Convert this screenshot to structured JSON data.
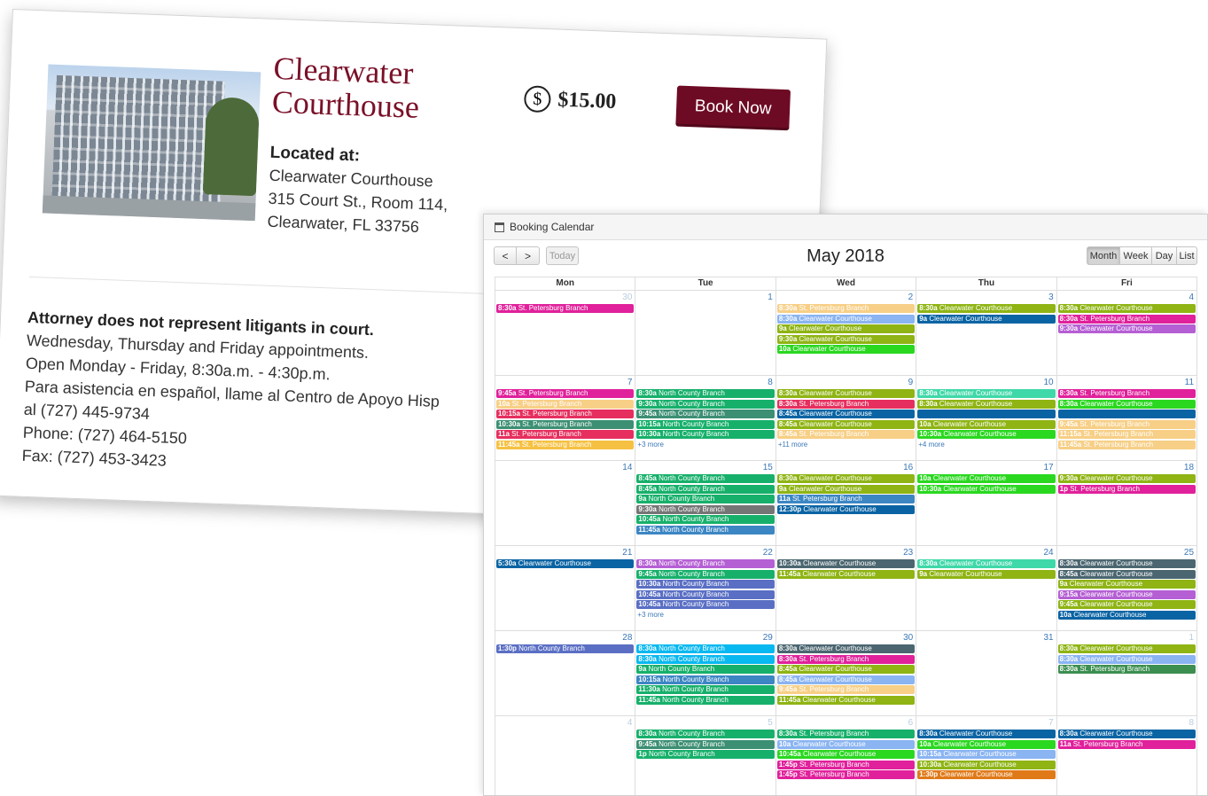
{
  "listing": {
    "title": "Clearwater Courthouse",
    "price_icon": "$",
    "price": "$15.00",
    "book_label": "Book Now",
    "located_heading": "Located at:",
    "address": [
      "Clearwater Courthouse",
      "315 Court St., Room 114,",
      "Clearwater, FL 33756"
    ],
    "notice": "Attorney does not represent litigants in court.",
    "info": [
      "Wednesday, Thursday and Friday appointments.",
      "Open Monday - Friday, 8:30a.m. - 4:30p.m.",
      "Para asistencia en español, llame al Centro de Apoyo Hisp",
      "al (727) 445-9734",
      "Phone: (727) 464-5150",
      "Fax: (727) 453-3423"
    ]
  },
  "calendar": {
    "header": "Booking Calendar",
    "month": "May 2018",
    "prev": "<",
    "next": ">",
    "today": "Today",
    "views": [
      "Month",
      "Week",
      "Day",
      "List"
    ],
    "days_of_week": [
      "Mon",
      "Tue",
      "Wed",
      "Thu",
      "Fri"
    ],
    "colors": {
      "magenta": "#e0219b",
      "peach": "#f7cf86",
      "red": "#e62f5e",
      "teal": "#3c8f73",
      "yellow": "#f6c142",
      "green": "#17b06b",
      "olive": "#8fb414",
      "gray": "#757575",
      "navy": "#0a64a4",
      "lime": "#2ad820",
      "sky": "#8ab4f2",
      "cyan": "#08b8f0",
      "purple": "#b55fd4",
      "mint": "#3fd8a8",
      "slate": "#4b6670",
      "steel": "#3c86c4",
      "indigo": "#5a6fc4",
      "orange": "#e07a18",
      "darkgreen": "#3c8f50"
    },
    "weeks": [
      [
        {
          "num": "30",
          "other": true,
          "events": [
            {
              "t": "8:30a",
              "n": "St. Petersburg Branch",
              "c": "magenta"
            }
          ]
        },
        {
          "num": "1",
          "events": []
        },
        {
          "num": "2",
          "events": [
            {
              "t": "8:30a",
              "n": "St. Petersburg Branch",
              "c": "peach"
            },
            {
              "t": "8:30a",
              "n": "Clearwater Courthouse",
              "c": "sky"
            },
            {
              "t": "9a",
              "n": "Clearwater Courthouse",
              "c": "olive"
            },
            {
              "t": "9:30a",
              "n": "Clearwater Courthouse",
              "c": "olive"
            },
            {
              "t": "10a",
              "n": "Clearwater Courthouse",
              "c": "lime"
            }
          ]
        },
        {
          "num": "3",
          "events": [
            {
              "t": "8:30a",
              "n": "Clearwater Courthouse",
              "c": "olive"
            },
            {
              "t": "9a",
              "n": "Clearwater Courthouse",
              "c": "navy"
            }
          ]
        },
        {
          "num": "4",
          "events": [
            {
              "t": "8:30a",
              "n": "Clearwater Courthouse",
              "c": "olive"
            },
            {
              "t": "8:30a",
              "n": "St. Petersburg Branch",
              "c": "magenta"
            },
            {
              "t": "9:30a",
              "n": "Clearwater Courthouse",
              "c": "purple"
            }
          ]
        }
      ],
      [
        {
          "num": "7",
          "events": [
            {
              "t": "9:45a",
              "n": "St. Petersburg Branch",
              "c": "magenta"
            },
            {
              "t": "10a",
              "n": "St. Petersburg Branch",
              "c": "peach"
            },
            {
              "t": "10:15a",
              "n": "St. Petersburg Branch",
              "c": "red"
            },
            {
              "t": "10:30a",
              "n": "St. Petersburg Branch",
              "c": "teal"
            },
            {
              "t": "11a",
              "n": "St. Petersburg Branch",
              "c": "red"
            },
            {
              "t": "11:45a",
              "n": "St. Petersburg Branch",
              "c": "yellow"
            }
          ]
        },
        {
          "num": "8",
          "events": [
            {
              "t": "8:30a",
              "n": "North County Branch",
              "c": "green"
            },
            {
              "t": "9:30a",
              "n": "North County Branch",
              "c": "green"
            },
            {
              "t": "9:45a",
              "n": "North County Branch",
              "c": "teal"
            },
            {
              "t": "10:15a",
              "n": "North County Branch",
              "c": "green"
            },
            {
              "t": "10:30a",
              "n": "North County Branch",
              "c": "green"
            }
          ],
          "more": "+3 more"
        },
        {
          "num": "9",
          "events": [
            {
              "t": "8:30a",
              "n": "Clearwater Courthouse",
              "c": "olive"
            },
            {
              "t": "8:30a",
              "n": "St. Petersburg Branch",
              "c": "red"
            },
            {
              "t": "8:45a",
              "n": "Clearwater Courthouse",
              "c": "navy"
            },
            {
              "t": "8:45a",
              "n": "Clearwater Courthouse",
              "c": "olive"
            },
            {
              "t": "8:45a",
              "n": "St. Petersburg Branch",
              "c": "peach"
            }
          ],
          "more": "+11 more"
        },
        {
          "num": "10",
          "events": [
            {
              "t": "8:30a",
              "n": "Clearwater Courthouse",
              "c": "mint"
            },
            {
              "t": "8:30a",
              "n": "Clearwater Courthouse",
              "c": "olive"
            },
            {
              "t": "",
              "n": "",
              "c": "navy"
            },
            {
              "t": "10a",
              "n": "Clearwater Courthouse",
              "c": "olive"
            },
            {
              "t": "10:30a",
              "n": "Clearwater Courthouse",
              "c": "lime"
            }
          ],
          "more": "+4 more"
        },
        {
          "num": "11",
          "events": [
            {
              "t": "8:30a",
              "n": "St. Petersburg Branch",
              "c": "magenta"
            },
            {
              "t": "8:30a",
              "n": "Clearwater Courthouse",
              "c": "lime"
            },
            {
              "t": "",
              "n": "",
              "c": "navy"
            },
            {
              "t": "9:45a",
              "n": "St. Petersburg Branch",
              "c": "peach"
            },
            {
              "t": "11:15a",
              "n": "St. Petersburg Branch",
              "c": "peach"
            },
            {
              "t": "11:45a",
              "n": "St. Petersburg Branch",
              "c": "peach"
            }
          ]
        }
      ],
      [
        {
          "num": "14",
          "events": []
        },
        {
          "num": "15",
          "events": [
            {
              "t": "8:45a",
              "n": "North County Branch",
              "c": "green"
            },
            {
              "t": "8:45a",
              "n": "North County Branch",
              "c": "green"
            },
            {
              "t": "9a",
              "n": "North County Branch",
              "c": "green"
            },
            {
              "t": "9:30a",
              "n": "North County Branch",
              "c": "gray"
            },
            {
              "t": "10:45a",
              "n": "North County Branch",
              "c": "green"
            },
            {
              "t": "11:45a",
              "n": "North County Branch",
              "c": "steel"
            }
          ]
        },
        {
          "num": "16",
          "events": [
            {
              "t": "8:30a",
              "n": "Clearwater Courthouse",
              "c": "olive"
            },
            {
              "t": "9a",
              "n": "Clearwater Courthouse",
              "c": "olive"
            },
            {
              "t": "11a",
              "n": "St. Petersburg Branch",
              "c": "steel"
            },
            {
              "t": "12:30p",
              "n": "Clearwater Courthouse",
              "c": "navy"
            }
          ]
        },
        {
          "num": "17",
          "events": [
            {
              "t": "10a",
              "n": "Clearwater Courthouse",
              "c": "lime"
            },
            {
              "t": "10:30a",
              "n": "Clearwater Courthouse",
              "c": "lime"
            }
          ]
        },
        {
          "num": "18",
          "events": [
            {
              "t": "9:30a",
              "n": "Clearwater Courthouse",
              "c": "olive"
            },
            {
              "t": "1p",
              "n": "St. Petersburg Branch",
              "c": "magenta"
            }
          ]
        }
      ],
      [
        {
          "num": "21",
          "events": [
            {
              "t": "5:30a",
              "n": "Clearwater Courthouse",
              "c": "navy"
            }
          ]
        },
        {
          "num": "22",
          "events": [
            {
              "t": "8:30a",
              "n": "North County Branch",
              "c": "purple"
            },
            {
              "t": "9:45a",
              "n": "North County Branch",
              "c": "green"
            },
            {
              "t": "10:30a",
              "n": "North County Branch",
              "c": "indigo"
            },
            {
              "t": "10:45a",
              "n": "North County Branch",
              "c": "indigo"
            },
            {
              "t": "10:45a",
              "n": "North County Branch",
              "c": "indigo"
            }
          ],
          "more": "+3 more"
        },
        {
          "num": "23",
          "events": [
            {
              "t": "10:30a",
              "n": "Clearwater Courthouse",
              "c": "slate"
            },
            {
              "t": "11:45a",
              "n": "Clearwater Courthouse",
              "c": "olive"
            }
          ]
        },
        {
          "num": "24",
          "events": [
            {
              "t": "8:30a",
              "n": "Clearwater Courthouse",
              "c": "mint"
            },
            {
              "t": "9a",
              "n": "Clearwater Courthouse",
              "c": "olive"
            }
          ]
        },
        {
          "num": "25",
          "events": [
            {
              "t": "8:30a",
              "n": "Clearwater Courthouse",
              "c": "slate"
            },
            {
              "t": "8:45a",
              "n": "Clearwater Courthouse",
              "c": "slate"
            },
            {
              "t": "9a",
              "n": "Clearwater Courthouse",
              "c": "olive"
            },
            {
              "t": "9:15a",
              "n": "Clearwater Courthouse",
              "c": "purple"
            },
            {
              "t": "9:45a",
              "n": "Clearwater Courthouse",
              "c": "olive"
            },
            {
              "t": "10a",
              "n": "Clearwater Courthouse",
              "c": "navy"
            }
          ]
        }
      ],
      [
        {
          "num": "28",
          "events": [
            {
              "t": "1:30p",
              "n": "North County Branch",
              "c": "indigo"
            }
          ]
        },
        {
          "num": "29",
          "events": [
            {
              "t": "8:30a",
              "n": "North County Branch",
              "c": "cyan"
            },
            {
              "t": "8:30a",
              "n": "North County Branch",
              "c": "cyan"
            },
            {
              "t": "9a",
              "n": "North County Branch",
              "c": "green"
            },
            {
              "t": "10:15a",
              "n": "North County Branch",
              "c": "steel"
            },
            {
              "t": "11:30a",
              "n": "North County Branch",
              "c": "green"
            },
            {
              "t": "11:45a",
              "n": "North County Branch",
              "c": "green"
            }
          ]
        },
        {
          "num": "30",
          "events": [
            {
              "t": "8:30a",
              "n": "Clearwater Courthouse",
              "c": "slate"
            },
            {
              "t": "8:30a",
              "n": "St. Petersburg Branch",
              "c": "magenta"
            },
            {
              "t": "8:45a",
              "n": "Clearwater Courthouse",
              "c": "olive"
            },
            {
              "t": "8:45a",
              "n": "Clearwater Courthouse",
              "c": "sky"
            },
            {
              "t": "9:45a",
              "n": "St. Petersburg Branch",
              "c": "peach"
            },
            {
              "t": "11:45a",
              "n": "Clearwater Courthouse",
              "c": "olive"
            }
          ]
        },
        {
          "num": "31",
          "events": []
        },
        {
          "num": "1",
          "other": true,
          "events": [
            {
              "t": "8:30a",
              "n": "Clearwater Courthouse",
              "c": "olive"
            },
            {
              "t": "8:30a",
              "n": "Clearwater Courthouse",
              "c": "sky"
            },
            {
              "t": "8:30a",
              "n": "St. Petersburg Branch",
              "c": "darkgreen"
            }
          ]
        }
      ],
      [
        {
          "num": "4",
          "other": true,
          "events": []
        },
        {
          "num": "5",
          "other": true,
          "events": [
            {
              "t": "8:30a",
              "n": "North County Branch",
              "c": "green"
            },
            {
              "t": "9:45a",
              "n": "North County Branch",
              "c": "teal"
            },
            {
              "t": "1p",
              "n": "North County Branch",
              "c": "green"
            }
          ]
        },
        {
          "num": "6",
          "other": true,
          "events": [
            {
              "t": "8:30a",
              "n": "St. Petersburg Branch",
              "c": "green"
            },
            {
              "t": "10a",
              "n": "Clearwater Courthouse",
              "c": "sky"
            },
            {
              "t": "10:45a",
              "n": "Clearwater Courthouse",
              "c": "lime"
            },
            {
              "t": "1:45p",
              "n": "St. Petersburg Branch",
              "c": "magenta"
            },
            {
              "t": "1:45p",
              "n": "St. Petersburg Branch",
              "c": "magenta"
            }
          ]
        },
        {
          "num": "7",
          "other": true,
          "events": [
            {
              "t": "8:30a",
              "n": "Clearwater Courthouse",
              "c": "navy"
            },
            {
              "t": "10a",
              "n": "Clearwater Courthouse",
              "c": "lime"
            },
            {
              "t": "10:15a",
              "n": "Clearwater Courthouse",
              "c": "sky"
            },
            {
              "t": "10:30a",
              "n": "Clearwater Courthouse",
              "c": "olive"
            },
            {
              "t": "1:30p",
              "n": "Clearwater Courthouse",
              "c": "orange"
            }
          ]
        },
        {
          "num": "8",
          "other": true,
          "events": [
            {
              "t": "8:30a",
              "n": "Clearwater Courthouse",
              "c": "navy"
            },
            {
              "t": "11a",
              "n": "St. Petersburg Branch",
              "c": "magenta"
            }
          ]
        }
      ]
    ]
  }
}
